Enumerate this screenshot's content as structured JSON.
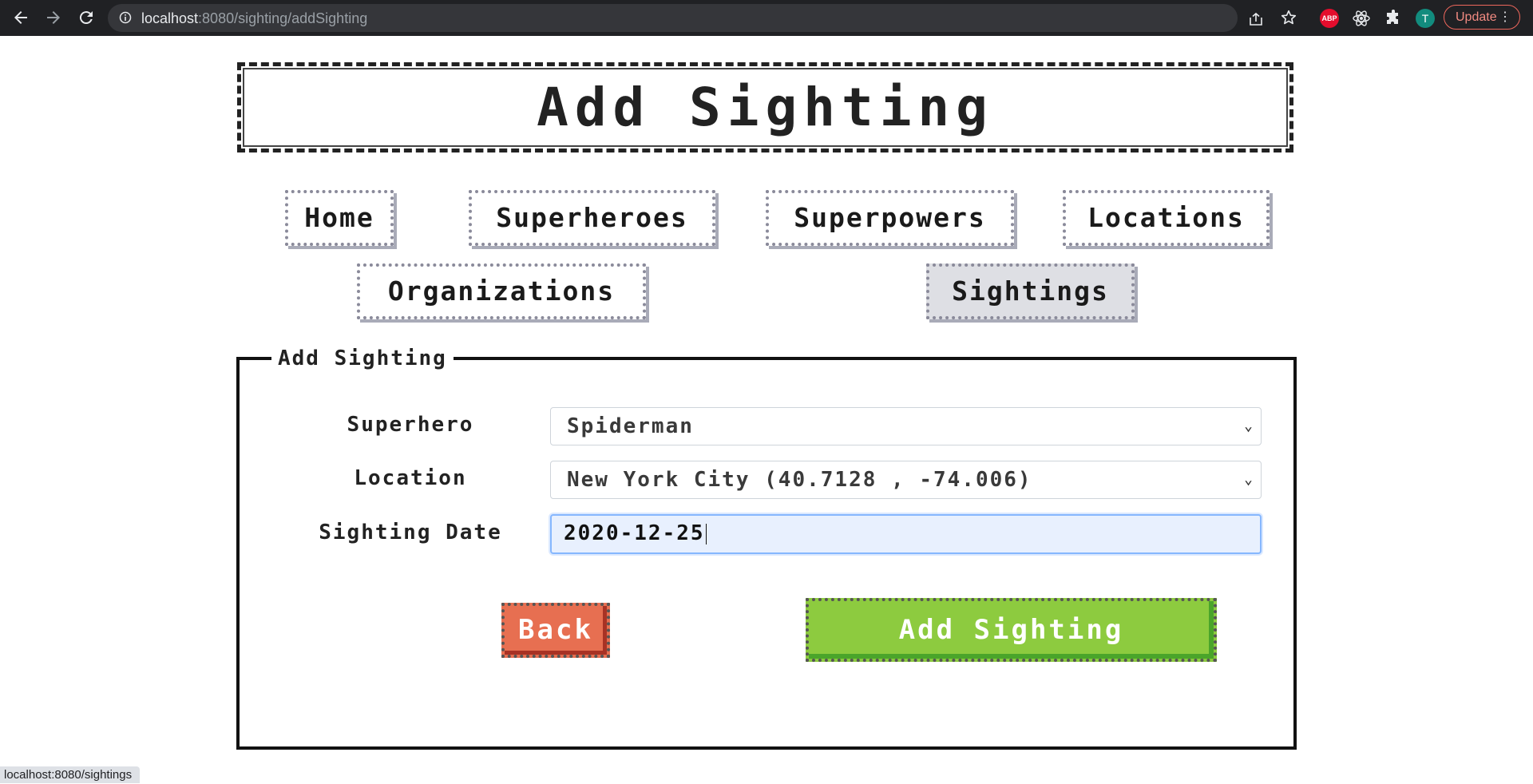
{
  "browser": {
    "url_host": "localhost",
    "url_path": ":8080/sighting/addSighting",
    "abp_label": "ABP",
    "avatar_letter": "T",
    "update_label": "Update",
    "menu_dots": "⋮",
    "icons": [
      "back-arrow-icon",
      "forward-arrow-icon",
      "reload-icon",
      "info-icon",
      "share-icon",
      "star-icon",
      "adblock-icon",
      "react-devtools-icon",
      "puzzle-icon"
    ]
  },
  "page": {
    "title": "Add Sighting",
    "nav": [
      {
        "label": "Home"
      },
      {
        "label": "Superheroes"
      },
      {
        "label": "Superpowers"
      },
      {
        "label": "Locations"
      },
      {
        "label": "Organizations"
      },
      {
        "label": "Sightings",
        "active": true
      }
    ]
  },
  "form": {
    "legend": "Add Sighting",
    "superhero_label": "Superhero",
    "superhero_value": "Spiderman",
    "location_label": "Location",
    "location_value": "New York City (40.7128 , -74.006)",
    "date_label": "Sighting Date",
    "date_value": "2020-12-25",
    "back_label": "Back",
    "submit_label": "Add Sighting"
  },
  "status_bar": {
    "hover_url": "localhost:8080/sightings"
  },
  "colors": {
    "back_button": "#e76f51",
    "submit_button": "#8dcb3f",
    "active_nav": "#dedfe4"
  }
}
